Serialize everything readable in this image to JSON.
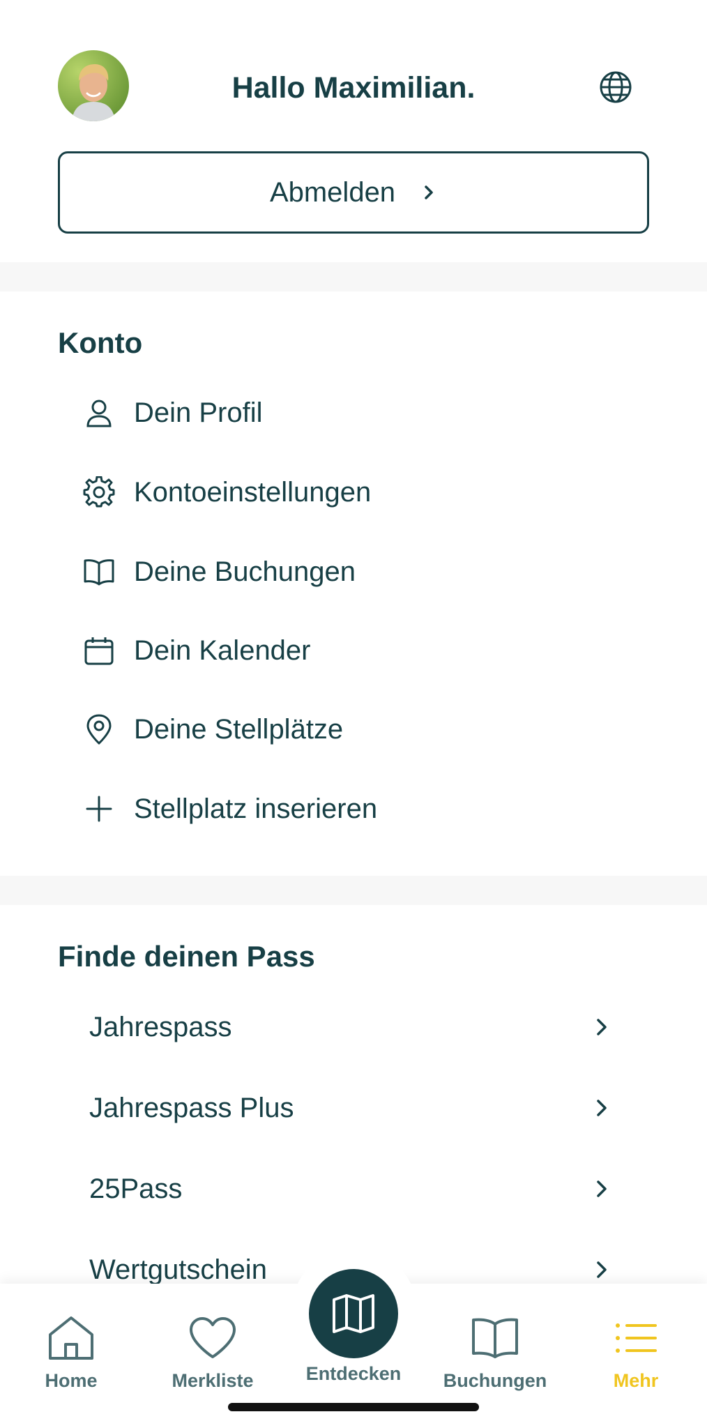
{
  "header": {
    "greeting": "Hallo Maximilian.",
    "logout_label": "Abmelden"
  },
  "konto": {
    "title": "Konto",
    "items": [
      {
        "label": "Dein Profil",
        "icon": "user-icon"
      },
      {
        "label": "Kontoeinstellungen",
        "icon": "gear-icon"
      },
      {
        "label": "Deine Buchungen",
        "icon": "book-icon"
      },
      {
        "label": "Dein Kalender",
        "icon": "calendar-icon"
      },
      {
        "label": "Deine Stellplätze",
        "icon": "location-pin-icon"
      },
      {
        "label": "Stellplatz inserieren",
        "icon": "plus-icon"
      }
    ]
  },
  "passes": {
    "title": "Finde deinen Pass",
    "items": [
      {
        "label": "Jahrespass"
      },
      {
        "label": "Jahrespass Plus"
      },
      {
        "label": "25Pass"
      },
      {
        "label": "Wertgutschein"
      }
    ]
  },
  "tabbar": {
    "tabs": [
      {
        "label": "Home",
        "icon": "home-icon"
      },
      {
        "label": "Merkliste",
        "icon": "heart-icon"
      },
      {
        "label": "Entdecken",
        "icon": "map-icon"
      },
      {
        "label": "Buchungen",
        "icon": "book-icon"
      },
      {
        "label": "Mehr",
        "icon": "list-icon",
        "active": true
      }
    ]
  },
  "colors": {
    "primary": "#173f45",
    "accent": "#f0c51f",
    "tab_inactive": "#4d6e73",
    "separator": "#f7f7f7"
  }
}
